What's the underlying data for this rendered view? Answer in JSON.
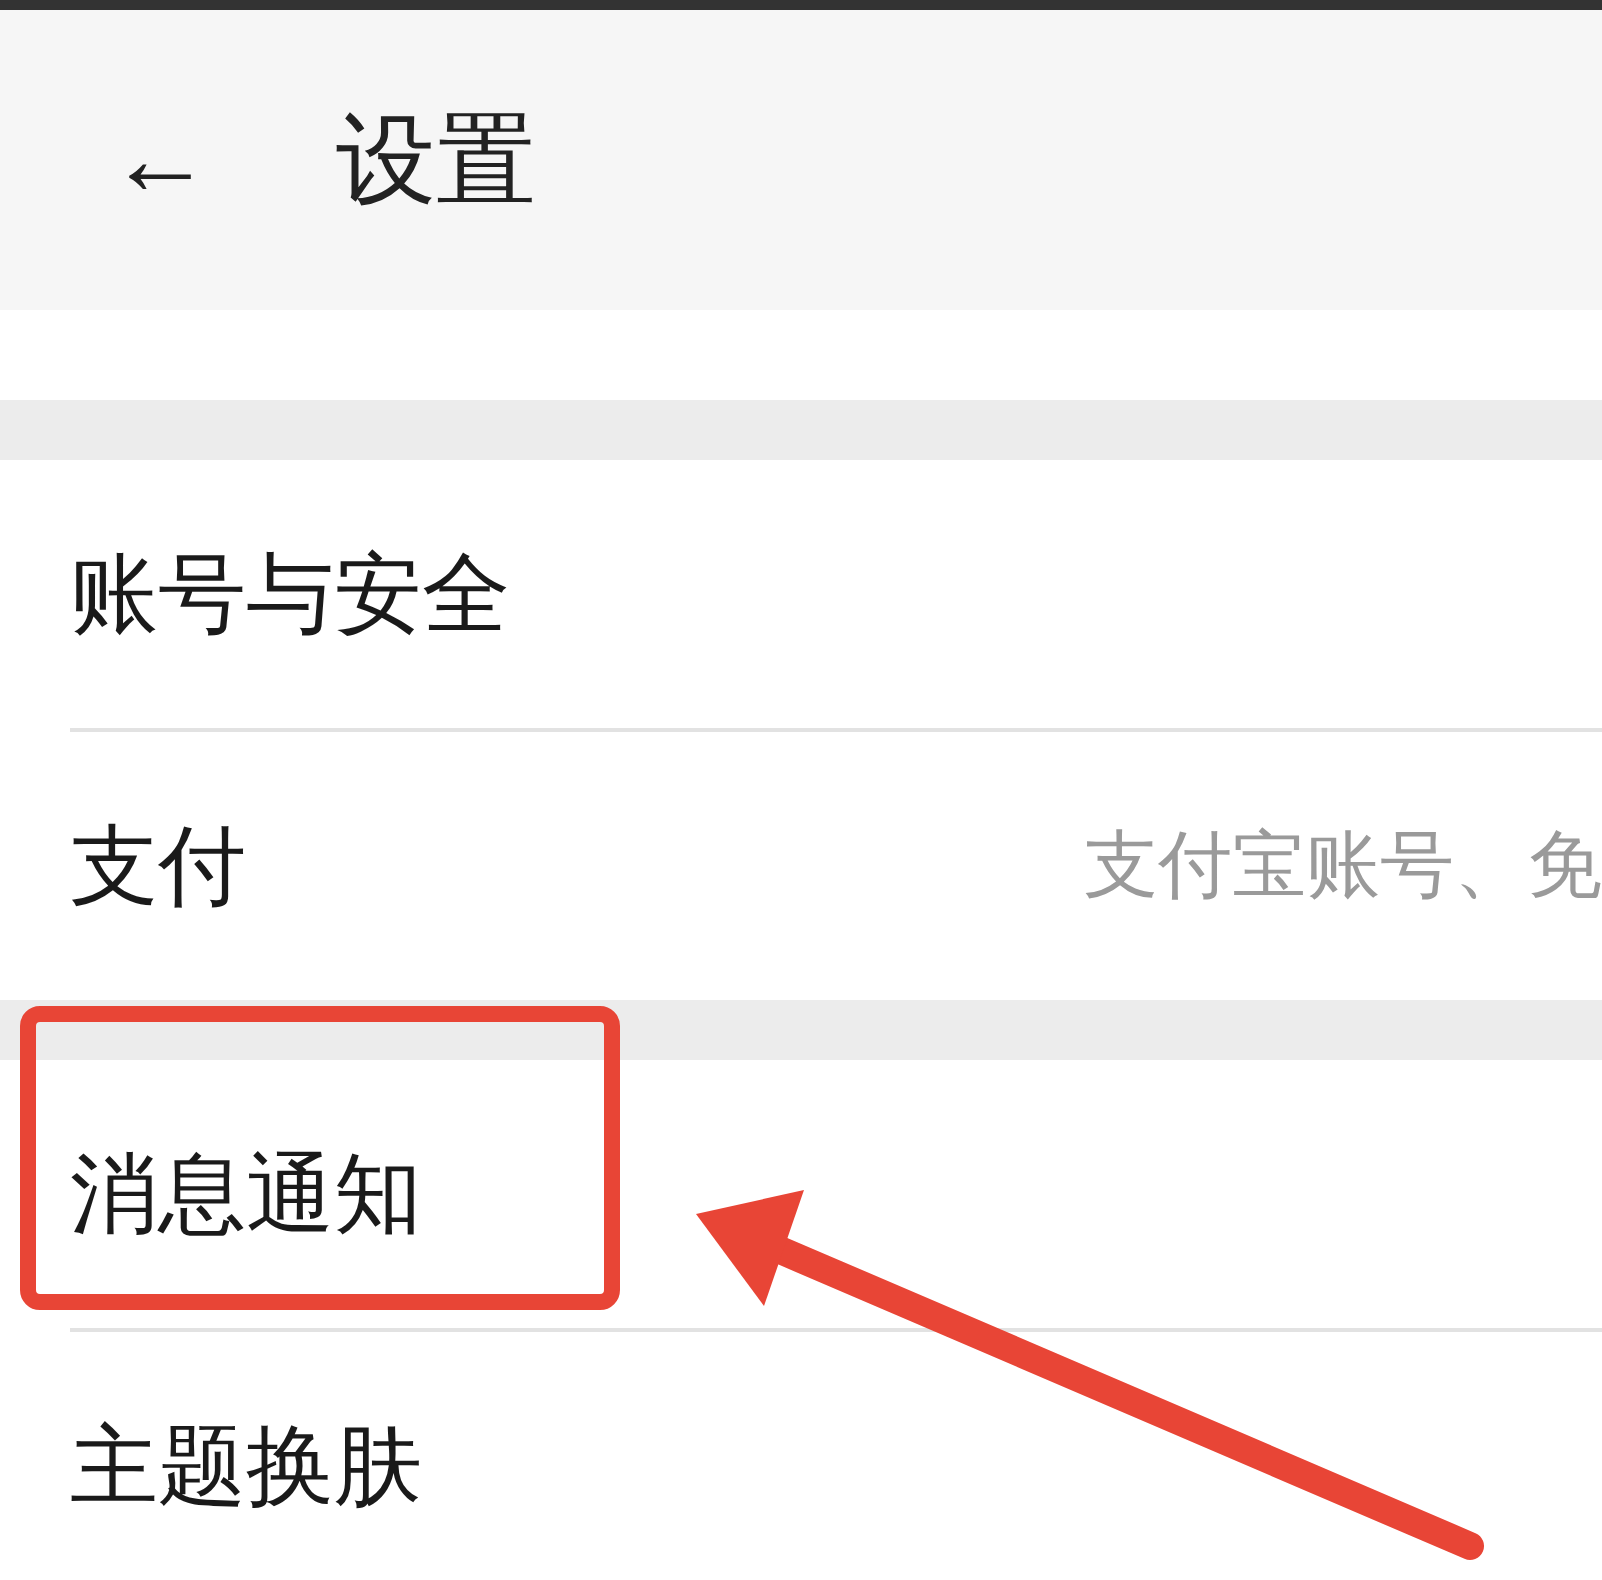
{
  "header": {
    "back_icon": "←",
    "title": "设置"
  },
  "groups": [
    {
      "rows": [
        {
          "label": "账号与安全",
          "highlighted": false
        },
        {
          "label": "支付",
          "detail": "支付宝账号、免",
          "highlighted": false
        }
      ]
    },
    {
      "rows": [
        {
          "label": "消息通知",
          "highlighted": true
        },
        {
          "label": "主题换肤",
          "highlighted": false
        }
      ]
    }
  ]
}
